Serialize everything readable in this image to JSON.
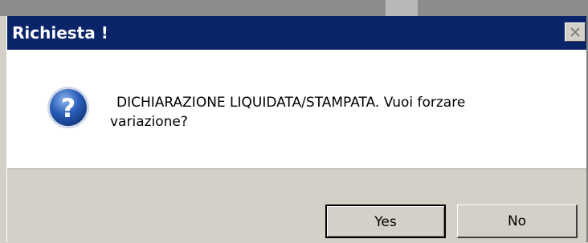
{
  "dialog": {
    "title": "Richiesta !",
    "message_line1": "DICHIARAZIONE LIQUIDATA/STAMPATA. Vuoi forzare",
    "message_line2": "variazione?",
    "icon": "question-icon",
    "close_icon": "close-icon"
  },
  "buttons": {
    "yes_label": "Yes",
    "no_label": "No"
  },
  "colors": {
    "titlebar": "#0a246a",
    "face": "#d4d0c8",
    "icon_blue": "#2a5fb8"
  }
}
